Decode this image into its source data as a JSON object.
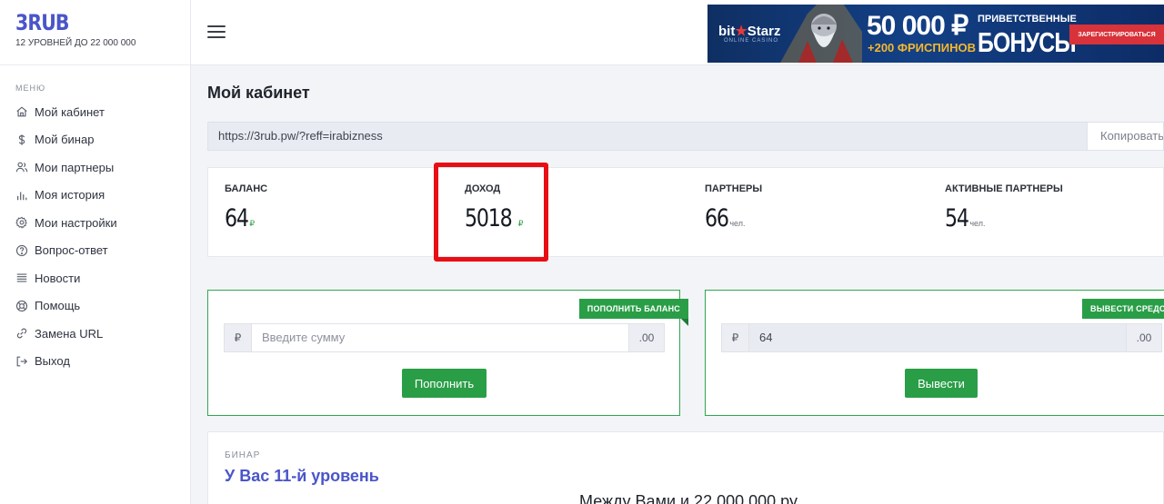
{
  "brand": {
    "logo": "3RUB",
    "subtitle": "12 УРОВНЕЙ ДО 22 000 000"
  },
  "sidebar": {
    "caption": "МЕНЮ",
    "items": [
      {
        "label": "Мой кабинет",
        "icon": "home-icon"
      },
      {
        "label": "Мой бинар",
        "icon": "dollar-icon"
      },
      {
        "label": "Мои партнеры",
        "icon": "users-icon"
      },
      {
        "label": "Моя история",
        "icon": "bar-chart-icon"
      },
      {
        "label": "Мои настройки",
        "icon": "gear-icon"
      },
      {
        "label": "Вопрос-ответ",
        "icon": "question-icon"
      },
      {
        "label": "Новости",
        "icon": "list-icon"
      },
      {
        "label": "Помощь",
        "icon": "lifebuoy-icon"
      },
      {
        "label": "Замена URL",
        "icon": "link-icon"
      },
      {
        "label": "Выход",
        "icon": "logout-icon"
      }
    ]
  },
  "banner": {
    "logo_left": "bit",
    "logo_right": "Starz",
    "logo_sub": "ONLINE CASINO",
    "amount": "50 000 ₽",
    "freespins": "+200 ФРИСПИНОВ",
    "greeting": "ПРИВЕТСТВЕННЫЕ",
    "bonus": "БОНУСЫ",
    "register": "ЗАРЕГИСТРИРОВАТЬСЯ"
  },
  "main": {
    "title": "Мой кабинет",
    "ref_link": "https://3rub.pw/?reff=irabizness",
    "copy_label": "Копировать"
  },
  "stats": [
    {
      "label": "БАЛАНС",
      "value": "64",
      "unit": "₽"
    },
    {
      "label": "ДОХОД",
      "value": "5018",
      "unit": "₽"
    },
    {
      "label": "ПАРТНЕРЫ",
      "value": "66",
      "unit": "чел."
    },
    {
      "label": "АКТИВНЫЕ ПАРТНЕРЫ",
      "value": "54",
      "unit": "чел."
    }
  ],
  "deposit": {
    "tag": "ПОПОЛНИТЬ БАЛАНС",
    "prefix": "₽",
    "placeholder": "Введите сумму",
    "suffix": ".00",
    "button": "Пополнить"
  },
  "withdraw": {
    "tag": "ВЫВЕСТИ СРЕДСТВА",
    "prefix": "₽",
    "value": "64",
    "suffix": ".00",
    "button": "Вывести"
  },
  "binar": {
    "caption": "БИНАР",
    "title": "У Вас 11-й уровень",
    "text": "Между Вами и 22 000 000 ру"
  },
  "colors": {
    "brand": "#4a55c9",
    "green": "#2a9e47",
    "highlight": "#e80e14"
  }
}
